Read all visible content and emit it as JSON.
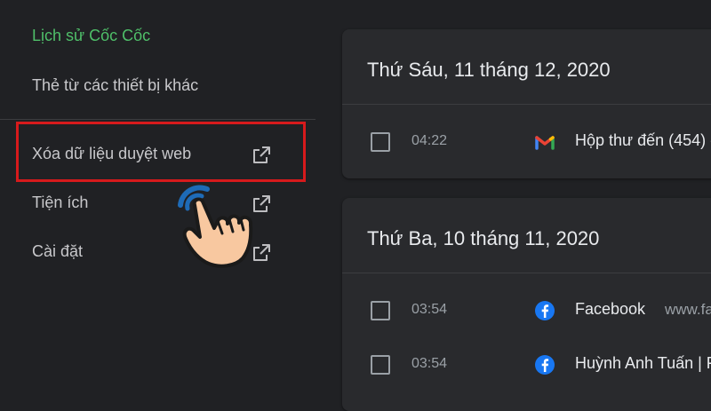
{
  "sidebar": {
    "items": [
      {
        "label": "Lịch sử Cốc Cốc"
      },
      {
        "label": "Thẻ từ các thiết bị khác"
      },
      {
        "label": "Xóa dữ liệu duyệt web"
      },
      {
        "label": "Tiện ích"
      },
      {
        "label": "Cài đặt"
      }
    ],
    "icons": {
      "external_link": "external-link-icon",
      "pointer": "hand-pointer-icon"
    },
    "colors": {
      "active": "#4fbf69",
      "highlight": "#d71a1c"
    }
  },
  "history": {
    "groups": [
      {
        "date": "Thứ Sáu, 11 tháng 12, 2020",
        "entries": [
          {
            "time": "04:22",
            "title": "Hộp thư đến (454) -",
            "favicon": "gmail-icon"
          }
        ]
      },
      {
        "date": "Thứ Ba, 10 tháng 11, 2020",
        "entries": [
          {
            "time": "03:54",
            "title": "Facebook",
            "domain": "www.fa",
            "favicon": "facebook-icon"
          },
          {
            "time": "03:54",
            "title": "Huỳnh Anh Tuấn | F",
            "favicon": "facebook-icon"
          }
        ]
      }
    ]
  }
}
